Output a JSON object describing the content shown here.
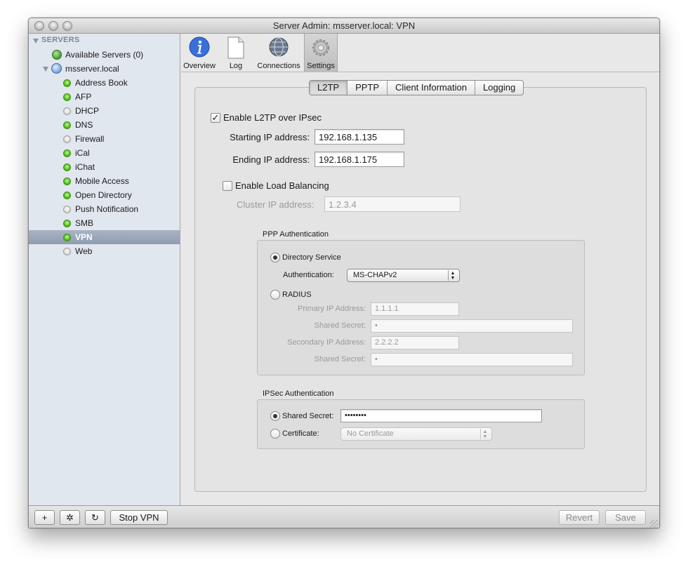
{
  "window": {
    "title": "Server Admin: msserver.local: VPN"
  },
  "sidebar": {
    "header": "SERVERS",
    "available": "Available Servers (0)",
    "server": "msserver.local",
    "services": [
      {
        "label": "Address Book",
        "status": "running"
      },
      {
        "label": "AFP",
        "status": "running"
      },
      {
        "label": "DHCP",
        "status": "stopped"
      },
      {
        "label": "DNS",
        "status": "running"
      },
      {
        "label": "Firewall",
        "status": "stopped"
      },
      {
        "label": "iCal",
        "status": "running"
      },
      {
        "label": "iChat",
        "status": "running"
      },
      {
        "label": "Mobile Access",
        "status": "running"
      },
      {
        "label": "Open Directory",
        "status": "running"
      },
      {
        "label": "Push Notification",
        "status": "stopped"
      },
      {
        "label": "SMB",
        "status": "running"
      },
      {
        "label": "VPN",
        "status": "running",
        "selected": true
      },
      {
        "label": "Web",
        "status": "stopped"
      }
    ]
  },
  "toolbar": {
    "items": [
      {
        "label": "Overview",
        "icon": "info-icon"
      },
      {
        "label": "Log",
        "icon": "document-icon"
      },
      {
        "label": "Connections",
        "icon": "network-globe-icon"
      },
      {
        "label": "Settings",
        "icon": "gear-icon",
        "active": true
      }
    ]
  },
  "tabs": [
    {
      "label": "L2TP",
      "selected": true
    },
    {
      "label": "PPTP"
    },
    {
      "label": "Client Information"
    },
    {
      "label": "Logging"
    }
  ],
  "l2tp": {
    "enable_label": "Enable L2TP over IPsec",
    "enable_checked": true,
    "start_label": "Starting IP address:",
    "start_value": "192.168.1.135",
    "end_label": "Ending IP address:",
    "end_value": "192.168.1.175",
    "lb_label": "Enable Load Balancing",
    "lb_checked": false,
    "cluster_label": "Cluster IP address:",
    "cluster_value": "1.2.3.4"
  },
  "ppp": {
    "title": "PPP Authentication",
    "directory_label": "Directory Service",
    "auth_label": "Authentication:",
    "auth_value": "MS-CHAPv2",
    "radius_label": "RADIUS",
    "primary_label": "Primary IP Address:",
    "primary_value": "1.1.1.1",
    "secret1_label": "Shared Secret:",
    "secret1_value": "•",
    "secondary_label": "Secondary IP Address:",
    "secondary_value": "2.2.2.2",
    "secret2_label": "Shared Secret:",
    "secret2_value": "•"
  },
  "ipsec": {
    "title": "IPSec Authentication",
    "shared_label": "Shared Secret:",
    "shared_value": "••••••••",
    "cert_label": "Certificate:",
    "cert_value": "No Certificate"
  },
  "bottom": {
    "add": "+",
    "action": "✲",
    "refresh": "↻",
    "stop": "Stop VPN",
    "revert": "Revert",
    "save": "Save"
  },
  "colors": {
    "running": "#4fbf1b",
    "selection": "#9aa7b9"
  }
}
